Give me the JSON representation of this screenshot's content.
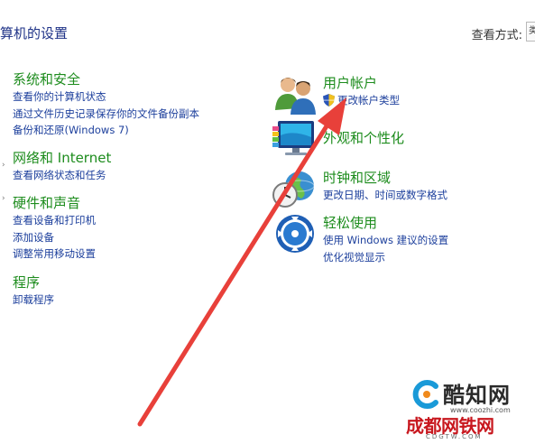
{
  "header": {
    "title": "算机的设置",
    "view_label": "查看方式:",
    "dropdown_glyph": "类"
  },
  "left": {
    "system": {
      "title": "系统和安全",
      "links": [
        "查看你的计算机状态",
        "通过文件历史记录保存你的文件备份副本",
        "备份和还原(Windows 7)"
      ]
    },
    "network": {
      "title": "网络和 Internet",
      "links": [
        "查看网络状态和任务"
      ]
    },
    "hardware": {
      "title": "硬件和声音",
      "links": [
        "查看设备和打印机",
        "添加设备",
        "调整常用移动设置"
      ]
    },
    "programs": {
      "title": "程序",
      "links": [
        "卸载程序"
      ]
    }
  },
  "right": {
    "user": {
      "title": "用户帐户",
      "links": [
        "更改帐户类型"
      ],
      "icon": "users-icon",
      "badge_icon": "uac-shield-icon"
    },
    "appearance": {
      "title": "外观和个性化",
      "icon": "monitor-icon"
    },
    "clock": {
      "title": "时钟和区域",
      "links": [
        "更改日期、时间或数字格式"
      ],
      "icon": "clock-globe-icon"
    },
    "ease": {
      "title": "轻松使用",
      "links": [
        "使用 Windows 建议的设置",
        "优化视觉显示"
      ],
      "icon": "ease-of-access-icon"
    }
  },
  "annotation": {
    "color": "#e8403a"
  },
  "watermarks": {
    "cool_name": "酷知网",
    "cool_url": "www.coozhi.com",
    "cd_name": "成都网铁网",
    "cd_url": "CDGTW.COM"
  },
  "colors": {
    "category_green": "#1d8c1d",
    "link_blue": "#1c3f9c",
    "title_blue": "#1e3287"
  }
}
